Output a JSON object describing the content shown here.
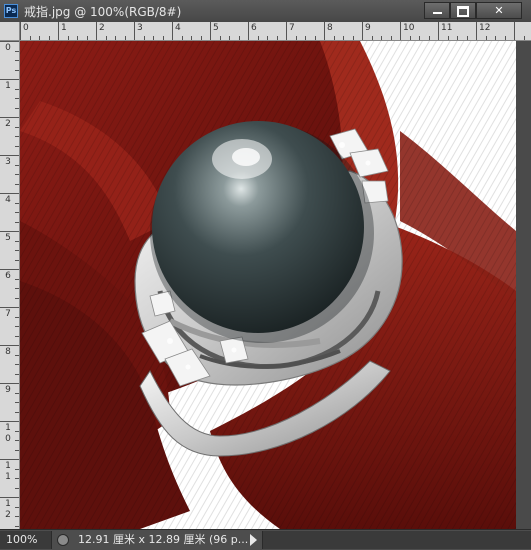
{
  "window": {
    "app_badge": "Ps",
    "title": "戒指.jpg @ 100%(RGB/8#)",
    "controls": {
      "minimize": "",
      "maximize": "",
      "close": "✕"
    }
  },
  "ruler": {
    "top_labels": [
      "0",
      "1",
      "2",
      "3",
      "4",
      "5",
      "6",
      "7",
      "8",
      "9",
      "10",
      "11",
      "12"
    ],
    "left_labels": [
      "0",
      "1",
      "2",
      "3",
      "4",
      "5",
      "6",
      "7",
      "8",
      "9",
      "10",
      "11",
      "12"
    ]
  },
  "status": {
    "zoom": "100%",
    "doc_info": "12.91 厘米 x 12.89 厘米 (96 p..."
  },
  "colors": {
    "fabric": "#7a1712",
    "pearl": "#3c4a4b",
    "metal": "#e6e6e6",
    "background": "#ffffff"
  }
}
